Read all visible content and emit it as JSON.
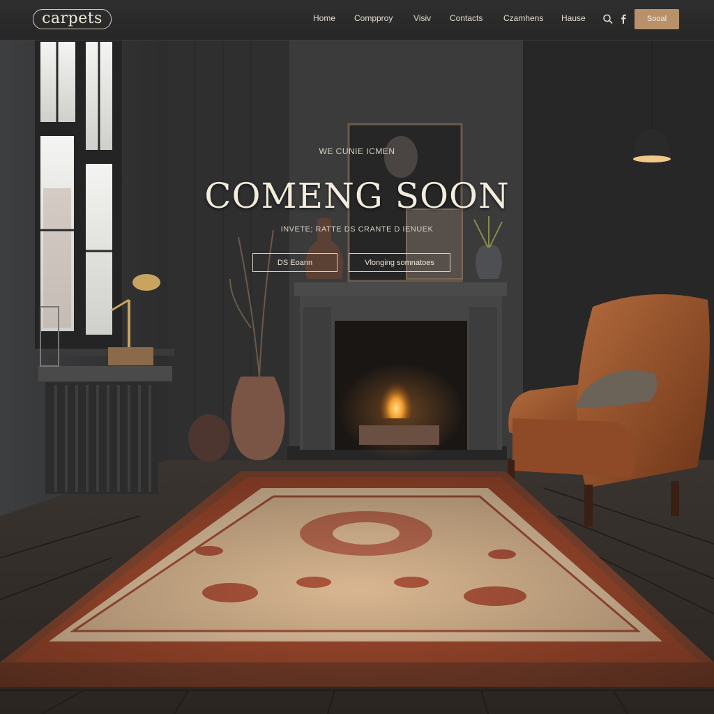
{
  "nav": {
    "logo": "carpets",
    "links": [
      "Home",
      "Compproy",
      "Visiv",
      "Contacts",
      "Czamhens",
      "Hause"
    ],
    "cta_label": "Sooal",
    "icons": [
      "search-icon",
      "facebook-icon"
    ]
  },
  "hero": {
    "eyebrow": "WE CUNIE ICMEN",
    "title": "COMENG SOON",
    "subtitle": "INVETE; RATTE DS CRANTE D IENUEK",
    "primary_button": "DS Eoann",
    "secondary_button": "Vlonging somnatoes"
  },
  "colors": {
    "nav_bg": "#2a2a2a",
    "accent": "#b8916a",
    "wall": "#3a3a3a",
    "floor": "#2b2624",
    "rug_field": "#d7b894",
    "rug_border": "#9c3d2a",
    "leather": "#8c4b28"
  }
}
